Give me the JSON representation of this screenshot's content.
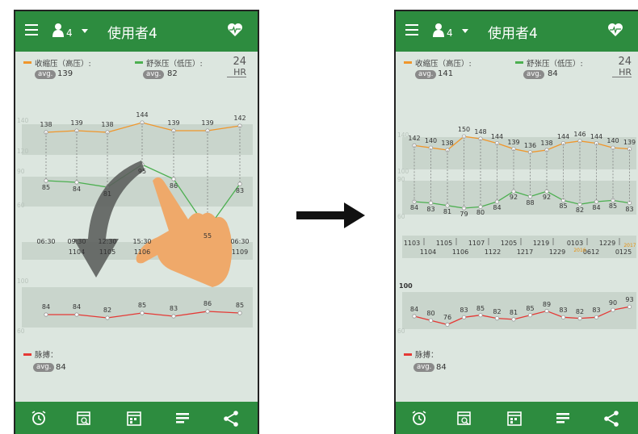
{
  "colors": {
    "green_bar": "#2d8c3f",
    "systolic": "#f0962b",
    "diastolic": "#4caf50",
    "pulse": "#e53935",
    "band": "#c9d5cc",
    "bg": "#dce6df"
  },
  "left": {
    "header": {
      "user_count": "4",
      "title": "使用者4",
      "icons": [
        "menu-icon",
        "user-icon",
        "chevron-down-icon",
        "heartbeat-icon"
      ]
    },
    "legend": {
      "systolic_label": "收缩压（高压）:",
      "systolic_avg": "139",
      "diastolic_label": "舒张压（低压）:",
      "diastolic_avg": "82",
      "avg_label": "avg.",
      "hr_value": "24",
      "hr_unit": "HR"
    },
    "scale": {
      "s140": "140",
      "s120": "120",
      "s90": "90",
      "s60": "60",
      "s100": "100",
      "s60b": "60"
    },
    "systolic": [
      138,
      139,
      138,
      144,
      139,
      139,
      142
    ],
    "diastolic": [
      85,
      84,
      81,
      95,
      86,
      55,
      83
    ],
    "times": [
      "06:30",
      "09:30",
      "12:30",
      "15:30",
      "",
      "",
      "06:30"
    ],
    "dates": [
      "",
      "1104",
      "1105",
      "1106",
      "",
      "",
      "1109"
    ],
    "pulse": [
      84,
      84,
      82,
      85,
      83,
      86,
      85
    ],
    "pulse_legend": {
      "label": "脉搏：",
      "avg": "84",
      "avg_label": "avg."
    },
    "bottom_icons": [
      "alarm-icon",
      "calendar-search-icon",
      "calendar-icon",
      "list-icon",
      "share-icon"
    ]
  },
  "right": {
    "header": {
      "user_count": "4",
      "title": "使用者4",
      "icons": [
        "menu-icon",
        "user-icon",
        "chevron-down-icon",
        "heartbeat-icon"
      ]
    },
    "legend": {
      "systolic_label": "收缩压（高压）:",
      "systolic_avg": "141",
      "diastolic_label": "舒张压（低压）:",
      "diastolic_avg": "84",
      "avg_label": "avg.",
      "hr_value": "24",
      "hr_unit": "HR"
    },
    "scale": {
      "s140": "140",
      "s100": "100",
      "s90": "90",
      "s60": "60",
      "p100": "100",
      "p60": "60"
    },
    "systolic": [
      142,
      140,
      138,
      150,
      148,
      144,
      139,
      136,
      138,
      144,
      146,
      144,
      140,
      139
    ],
    "diastolic": [
      84,
      83,
      81,
      79,
      80,
      84,
      92,
      88,
      92,
      85,
      82,
      84,
      85,
      83
    ],
    "dates_top": [
      "1103",
      "1105",
      "1107",
      "1205",
      "1219",
      "0103",
      "1229"
    ],
    "dates_bottom": [
      "1104",
      "1106",
      "1122",
      "1217",
      "1229",
      "0612",
      "0125"
    ],
    "year_labels": [
      "2016",
      "2017"
    ],
    "pulse": [
      84,
      80,
      76,
      83,
      85,
      82,
      81,
      85,
      89,
      83,
      82,
      83,
      90,
      93
    ],
    "pulse_legend": {
      "label": "脉搏：",
      "avg": "84",
      "avg_label": "avg."
    },
    "bottom_icons": [
      "alarm-icon",
      "calendar-search-icon",
      "calendar-icon",
      "list-icon",
      "share-icon"
    ]
  }
}
